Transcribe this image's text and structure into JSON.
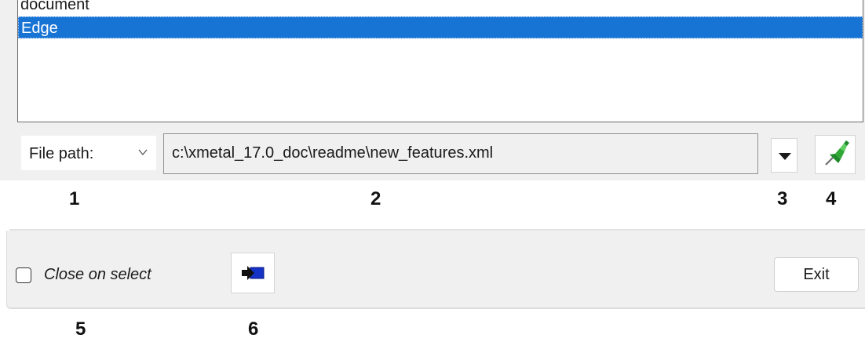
{
  "list": {
    "items": [
      "document",
      "Edge"
    ],
    "selected_index": 1
  },
  "path_row": {
    "type_select": {
      "value": "File path:"
    },
    "path_value": "c:\\xmetal_17.0_doc\\readme\\new_features.xml"
  },
  "callouts": {
    "n1": "1",
    "n2": "2",
    "n3": "3",
    "n4": "4",
    "n5": "5",
    "n6": "6"
  },
  "footer": {
    "close_on_select_label": "Close on select",
    "close_on_select_checked": false,
    "exit_label": "Exit"
  },
  "icons": {
    "path_type_dropdown": "chevron-down-icon",
    "history_dropdown": "triangle-down-icon",
    "pin": "green-pushpin-icon",
    "goto": "goto-arrow-icon"
  },
  "colors": {
    "selection": "#1874d4",
    "pin": "#2fa836",
    "goto_arrow": "#1633c8"
  }
}
